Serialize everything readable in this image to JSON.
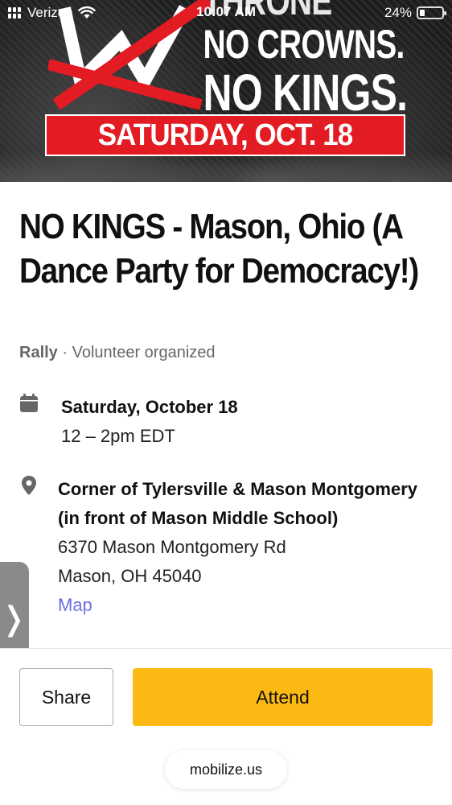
{
  "status_bar": {
    "carrier": "Verizon",
    "time": "10:07 AM",
    "battery_text": "24%",
    "battery_level": 0.24
  },
  "banner": {
    "headline_top": "THRONE",
    "headline_mid": "NO CROWNS.",
    "headline_bottom": "NO KINGS.",
    "date": "SATURDAY, OCT. 18",
    "accent_color": "#e31b23"
  },
  "event": {
    "title": "NO KINGS - Mason, Ohio (A Dance Party for Democracy!)",
    "type": "Rally",
    "separator": " · ",
    "organizer": "Volunteer organized",
    "date": "Saturday, October 18",
    "time": "12 – 2pm EDT",
    "location_name": "Corner of Tylersville & Mason Montgomery (in front of Mason Middle School)",
    "address_line1": "6370 Mason Montgomery Rd",
    "address_line2": "Mason, OH 45040",
    "map_label": "Map"
  },
  "actions": {
    "share_label": "Share",
    "attend_label": "Attend",
    "attend_color": "#fdb913"
  },
  "browser": {
    "url": "mobilize.us"
  },
  "side_tab": {
    "glyph": "❭"
  }
}
